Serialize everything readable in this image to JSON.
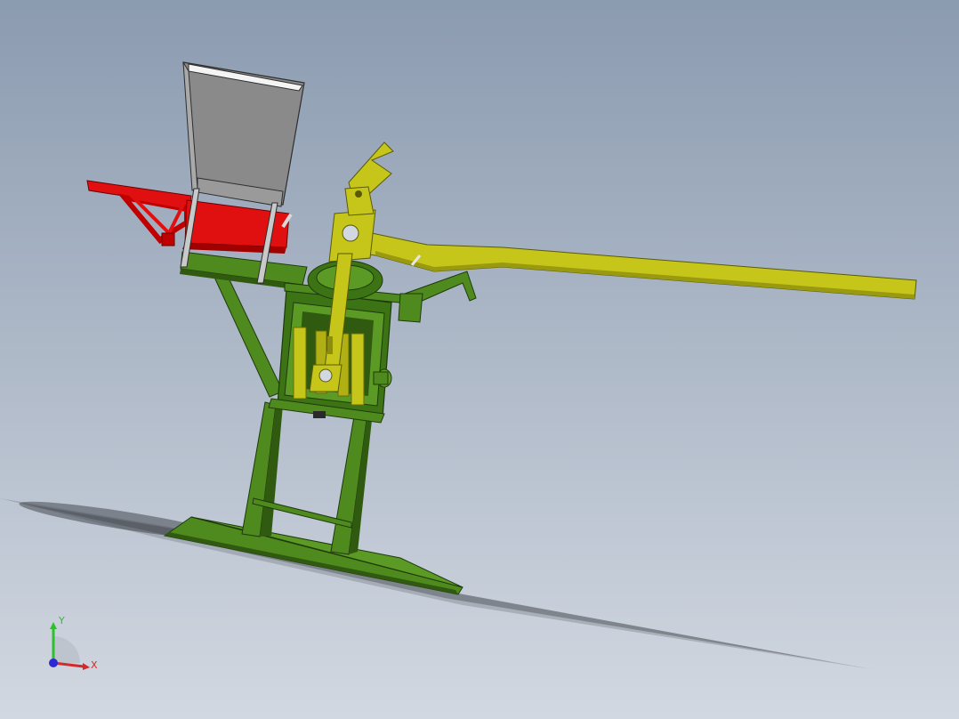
{
  "colors": {
    "background_top": "#8b9bb0",
    "background_bottom": "#d2d8e1",
    "frame": "#4e8a1e",
    "frame_dark": "#2f5a10",
    "tray": "#e01010",
    "hopper": "#8a8a8a",
    "hopper_light": "#b6b6b6",
    "lever": "#c6c61a",
    "lever_dark": "#8c8c10",
    "axis_x": "#d42a2a",
    "axis_y": "#2fbf2f",
    "axis_z": "#2a2ad4"
  },
  "triad": {
    "x_label": "X",
    "y_label": "Y"
  }
}
